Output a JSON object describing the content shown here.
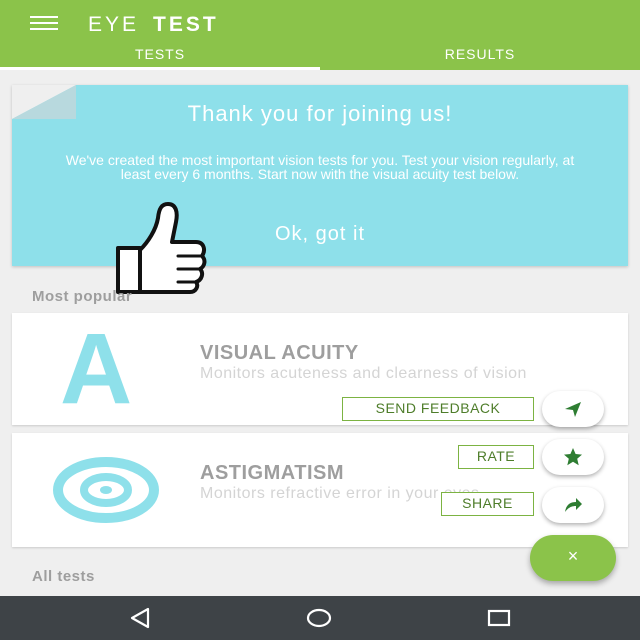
{
  "app": {
    "title_light": "EYE",
    "title_bold": "TEST",
    "menu_icon": "hamburger-menu-icon"
  },
  "tabs": [
    {
      "label": "TESTS",
      "active": true
    },
    {
      "label": "RESULTS",
      "active": false
    }
  ],
  "welcome": {
    "title": "Thank you for joining us!",
    "body": "We've created the most important vision tests for you. Test your vision regularly, at least every 6 months. Start now with the visual acuity test below.",
    "ok_label": "Ok, got it",
    "icon": "thumbs-up-icon"
  },
  "sections": {
    "most_popular": "Most popular",
    "all_tests": "All tests"
  },
  "tests": [
    {
      "title": "VISUAL ACUITY",
      "description": "Monitors acuteness and clearness of vision",
      "icon": "letter-a-icon"
    },
    {
      "title": "ASTIGMATISM",
      "description": "Monitors refractive error in your eyes",
      "icon": "target-icon"
    }
  ],
  "actions": {
    "send_feedback": "SEND FEEDBACK",
    "rate": "RATE",
    "share": "SHARE",
    "close_symbol": "×"
  },
  "colors": {
    "primary": "#8bc34a",
    "accent": "#8ee0ea",
    "nav_bar": "#3e4347"
  }
}
